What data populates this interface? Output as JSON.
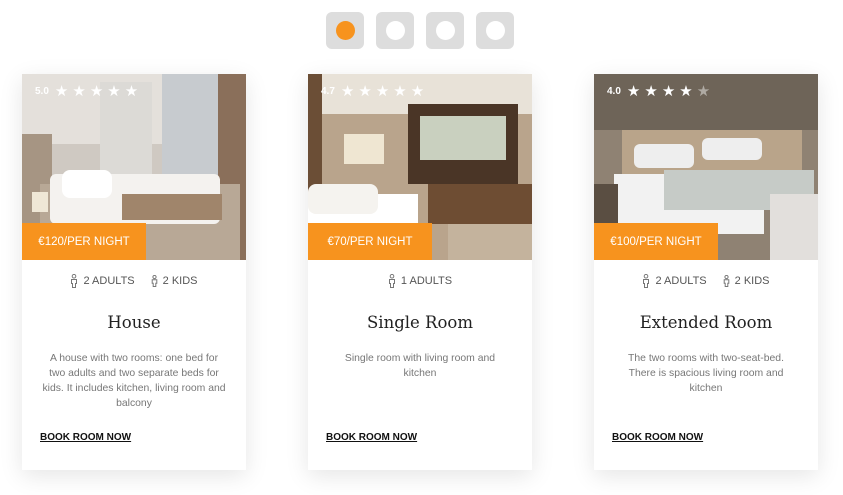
{
  "pager": {
    "count": 4,
    "active_index": 0
  },
  "colors": {
    "accent": "#f7931e",
    "pager_bg": "#dddddd"
  },
  "cards": [
    {
      "rating": "5.0",
      "stars_filled": 5,
      "price": "€120/PER NIGHT",
      "adults": "2 ADULTS",
      "kids": "2 KIDS",
      "title": "House",
      "description": "A house with two rooms: one bed for two adults and two separate beds for kids. It includes kitchen, living room and balcony",
      "cta": "BOOK ROOM NOW"
    },
    {
      "rating": "4.7",
      "stars_filled": 5,
      "price": "€70/PER NIGHT",
      "adults": "1 ADULTS",
      "title": "Single Room",
      "description": "Single room with living room and kitchen",
      "cta": "BOOK ROOM NOW"
    },
    {
      "rating": "4.0",
      "stars_filled": 4,
      "price": "€100/PER NIGHT",
      "adults": "2 ADULTS",
      "kids": "2 KIDS",
      "title": "Extended Room",
      "description": "The two rooms with two-seat-bed. There is spacious living room and kitchen",
      "cta": "BOOK ROOM NOW"
    }
  ]
}
